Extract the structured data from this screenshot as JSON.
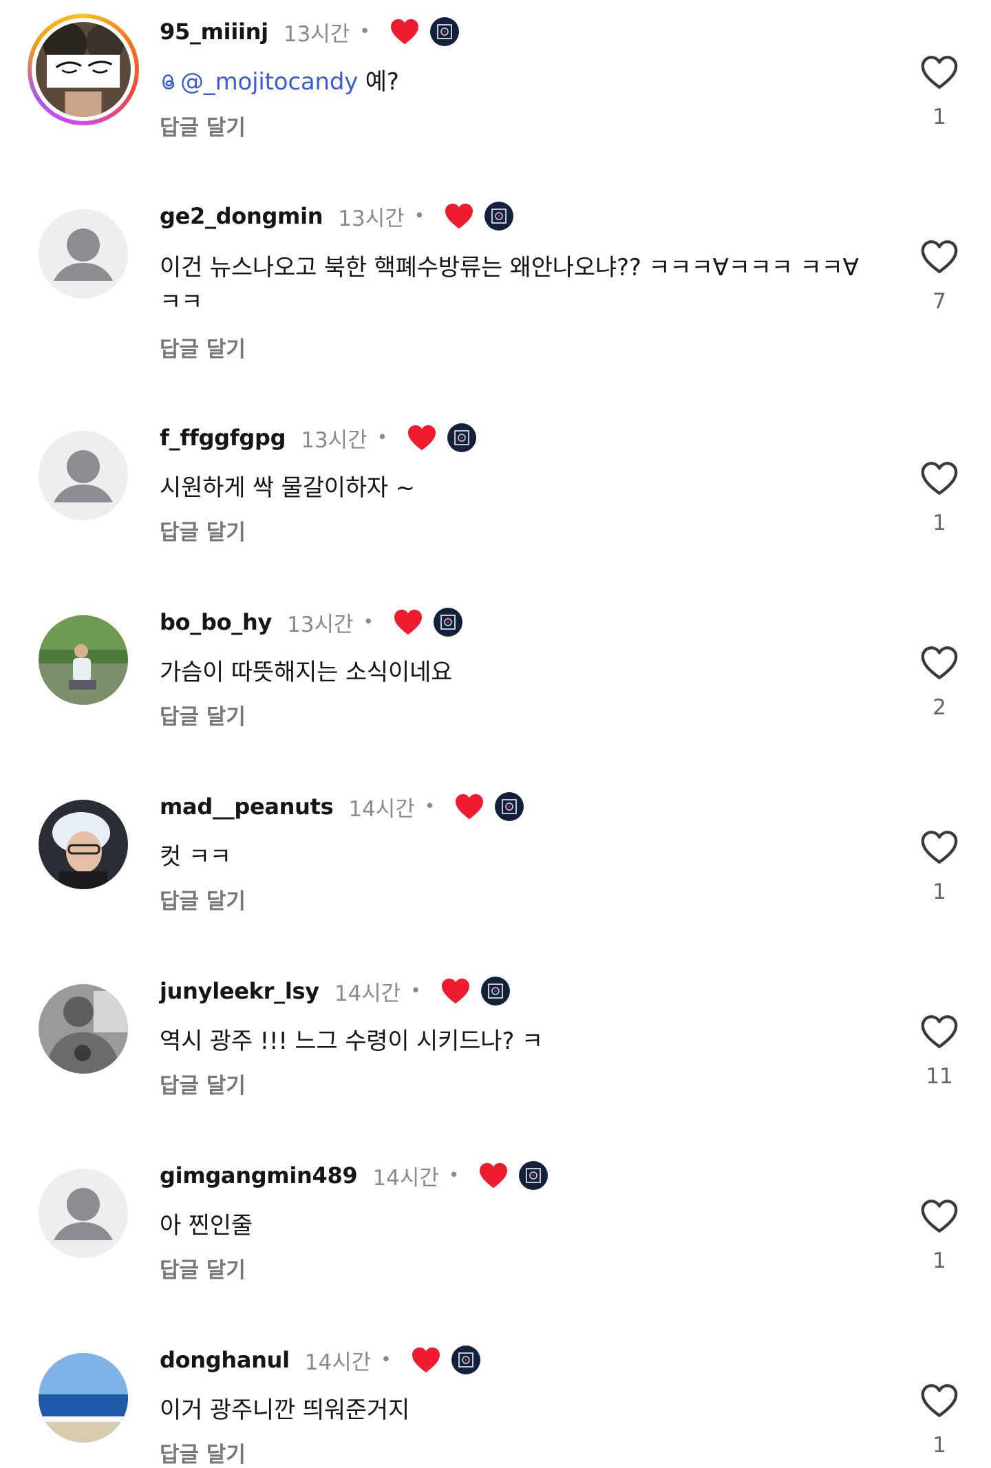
{
  "reply_label": "답글 달기",
  "comments": [
    {
      "username": "95_miiinj",
      "time": "13시간",
      "dot": "•",
      "mention": "@_mojitocandy",
      "text": " 예?",
      "likes": "1"
    },
    {
      "username": "ge2_dongmin",
      "time": "13시간",
      "dot": "•",
      "text": "이건 뉴스나오고 북한 핵폐수방류는 왜안나오냐?? ㅋㅋㅋ∀ㅋㅋㅋ ㅋㅋ∀ㅋㅋ",
      "likes": "7"
    },
    {
      "username": "f_ffggfgpg",
      "time": "13시간",
      "dot": "•",
      "text": "시원하게 싹 물갈이하자 ~",
      "likes": "1"
    },
    {
      "username": "bo_bo_hy",
      "time": "13시간",
      "dot": "•",
      "text": "가슴이 따뜻해지는 소식이네요",
      "likes": "2"
    },
    {
      "username": "mad__peanuts",
      "time": "14시간",
      "dot": "•",
      "text": "컷 ㅋㅋ",
      "likes": "1"
    },
    {
      "username": "junyleekr_lsy",
      "time": "14시간",
      "dot": "•",
      "text": "역시 광주 !!! 느그 수령이 시키드나? ㅋ",
      "likes": "11"
    },
    {
      "username": "gimgangmin489",
      "time": "14시간",
      "dot": "•",
      "text": "아 찐인줄",
      "likes": "1"
    },
    {
      "username": "donghanul",
      "time": "14시간",
      "dot": "•",
      "text": "이거 광주니깐 띄워준거지",
      "likes": "1"
    }
  ]
}
